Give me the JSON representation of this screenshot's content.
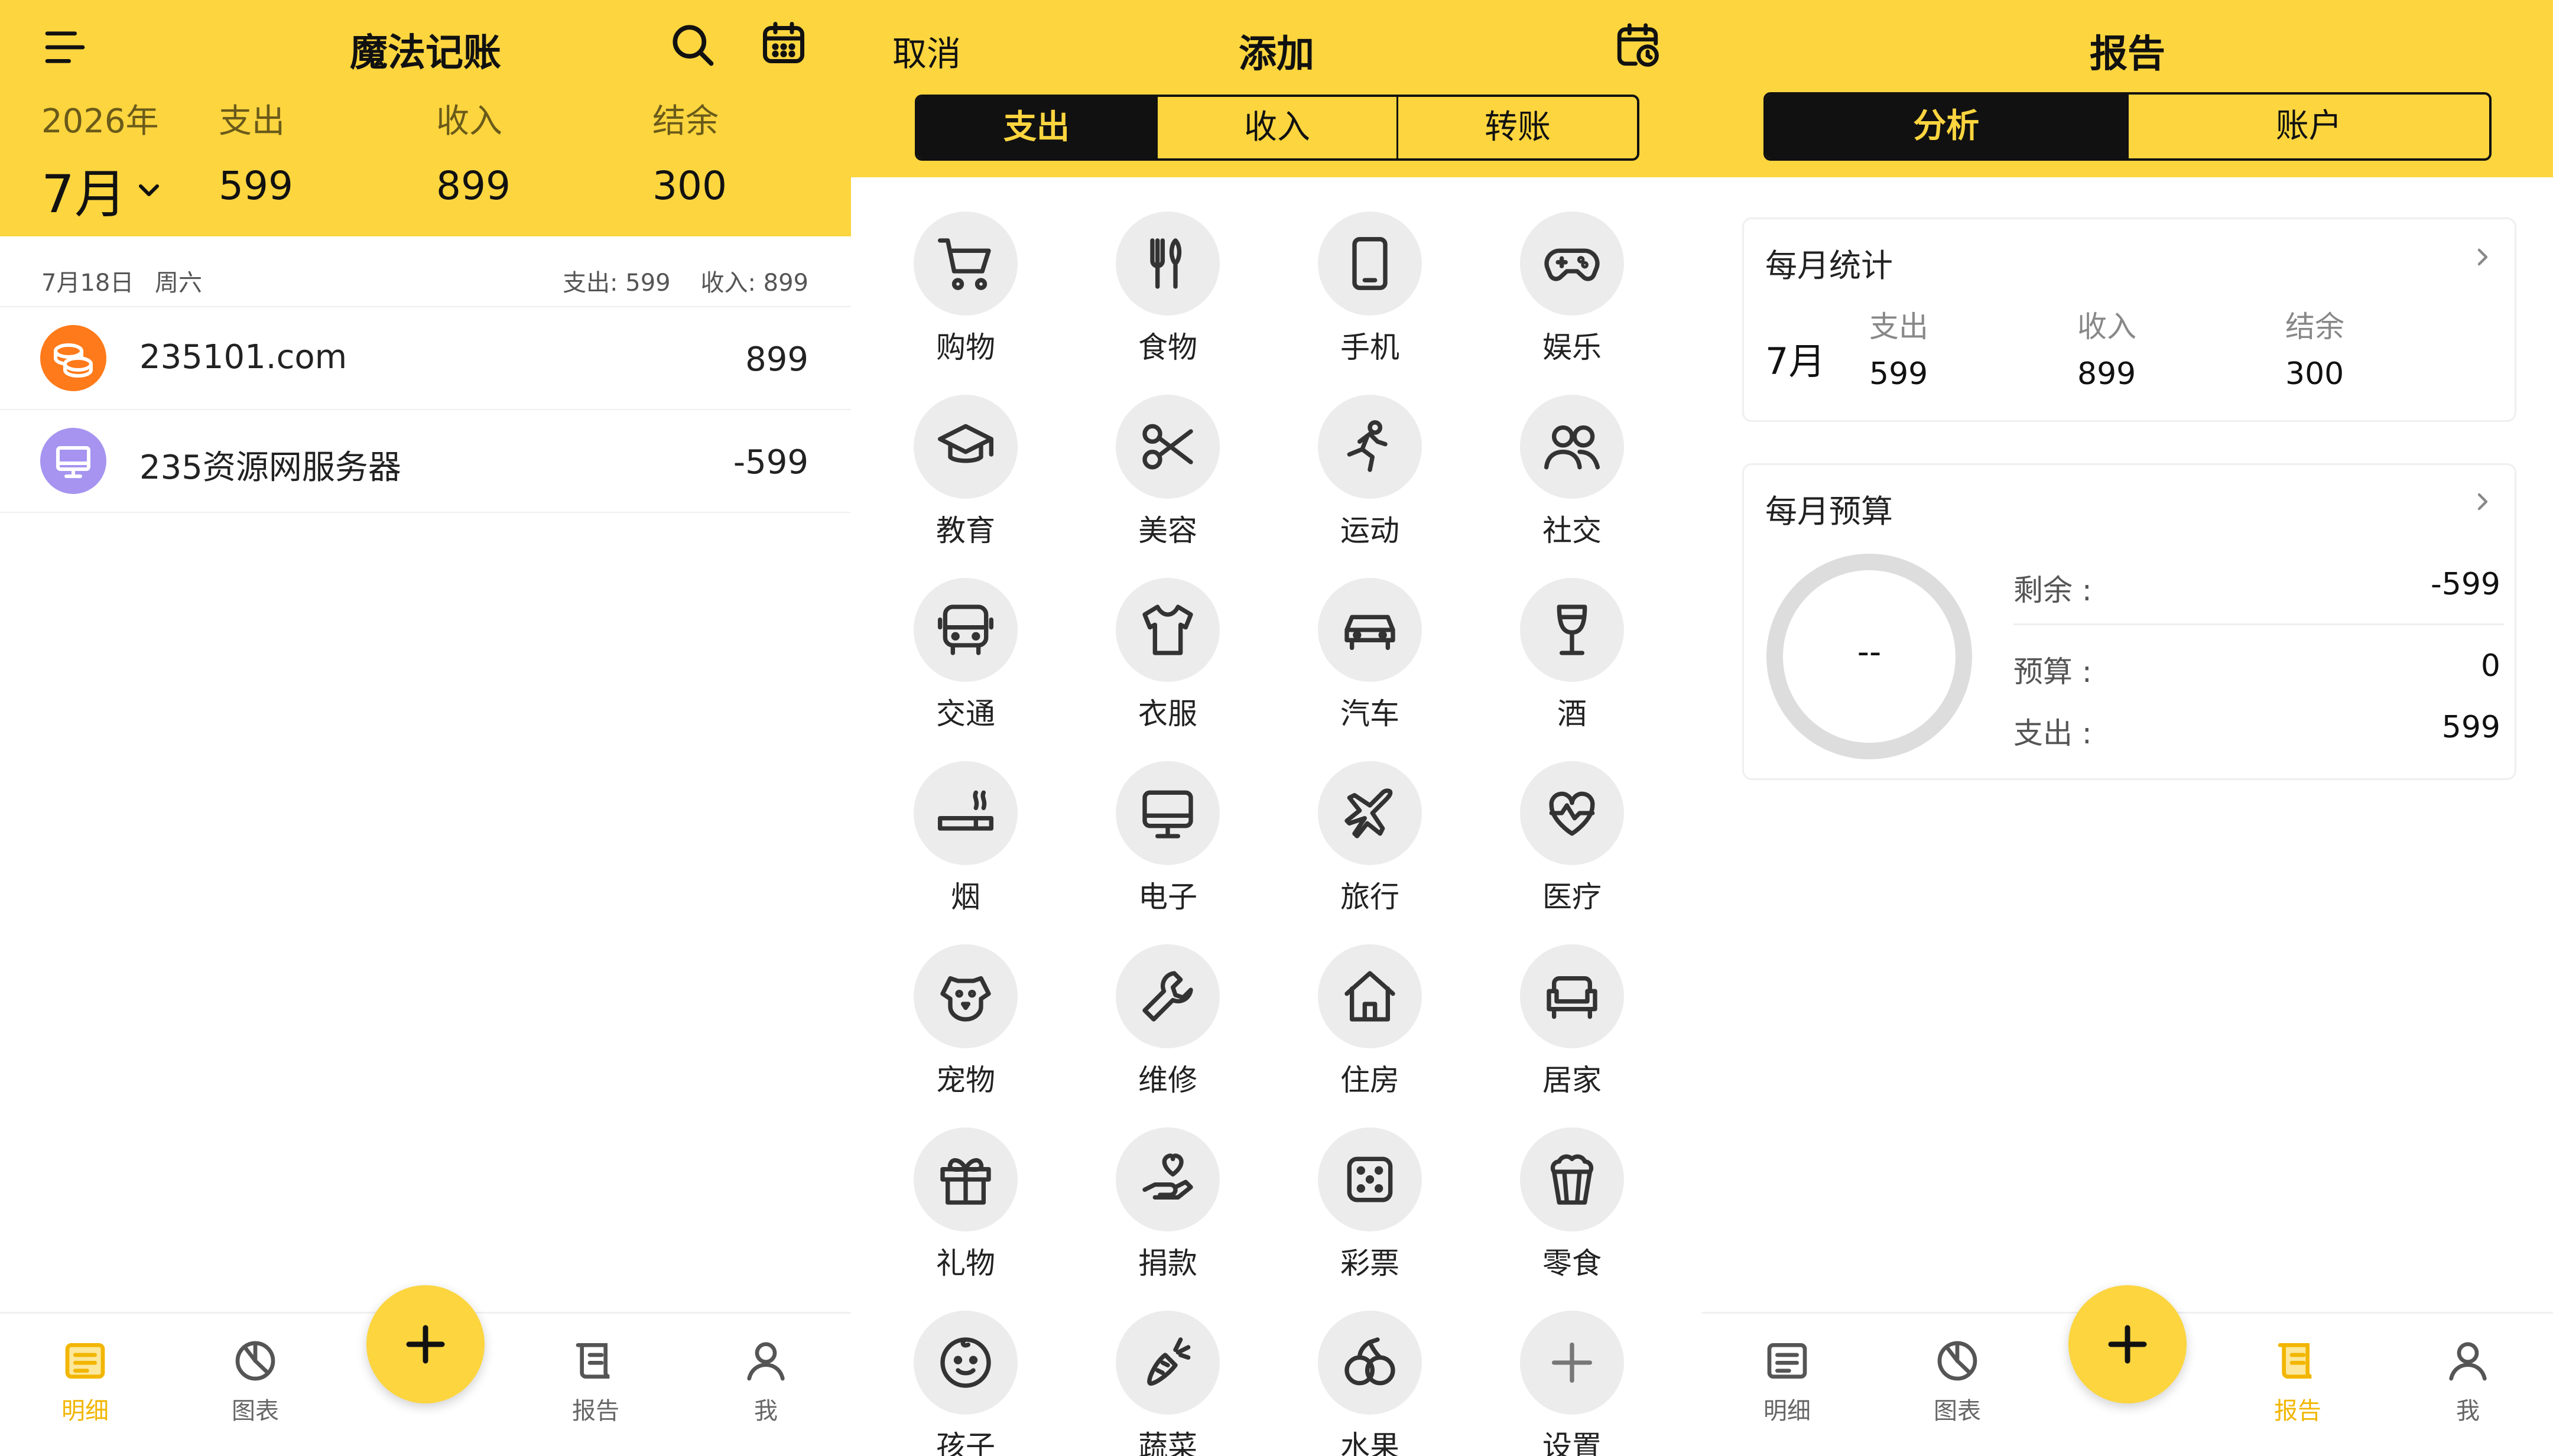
{
  "colors": {
    "accent": "#FCD53F",
    "orange": "#FF7A1A",
    "purple": "#A694F0",
    "active_nav": "#F2B600"
  },
  "screen1": {
    "title": "魔法记账",
    "year": "2026年",
    "month": "7月",
    "summary": {
      "expense_label": "支出",
      "expense": "599",
      "income_label": "收入",
      "income": "899",
      "balance_label": "结余",
      "balance": "300"
    },
    "day": {
      "date": "7月18日",
      "weekday": "周六",
      "totals": "支出: 599    收入: 899"
    },
    "entries": [
      {
        "name": "235101.com",
        "amount": "899",
        "icon": "coins-icon"
      },
      {
        "name": "235资源网服务器",
        "amount": "-599",
        "icon": "monitor-icon"
      }
    ],
    "nav": {
      "detail": "明细",
      "chart": "图表",
      "report": "报告",
      "me": "我"
    }
  },
  "screen2": {
    "cancel": "取消",
    "title": "添加",
    "tabs": [
      "支出",
      "收入",
      "转账"
    ],
    "categories": [
      "购物",
      "食物",
      "手机",
      "娱乐",
      "教育",
      "美容",
      "运动",
      "社交",
      "交通",
      "衣服",
      "汽车",
      "酒",
      "烟",
      "电子",
      "旅行",
      "医疗",
      "宠物",
      "维修",
      "住房",
      "居家",
      "礼物",
      "捐款",
      "彩票",
      "零食",
      "孩子",
      "蔬菜",
      "水果",
      "设置"
    ]
  },
  "screen3": {
    "title": "报告",
    "tabs": [
      "分析",
      "账户"
    ],
    "monthly_stats": {
      "title": "每月统计",
      "month": "7月",
      "expense_label": "支出",
      "expense": "599",
      "income_label": "收入",
      "income": "899",
      "balance_label": "结余",
      "balance": "300"
    },
    "monthly_budget": {
      "title": "每月预算",
      "ring_text": "--",
      "remaining_label": "剩余 :",
      "remaining": "-599",
      "budget_label": "预算 :",
      "budget": "0",
      "expense_label": "支出 :",
      "expense": "599"
    },
    "nav": {
      "detail": "明细",
      "chart": "图表",
      "report": "报告",
      "me": "我"
    }
  }
}
